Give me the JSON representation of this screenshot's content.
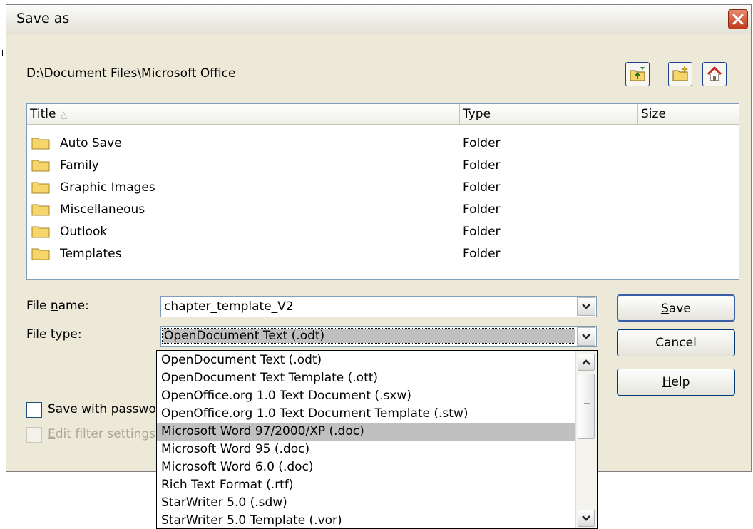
{
  "dialog": {
    "title": "Save as"
  },
  "path": "D:\\Document Files\\Microsoft Office",
  "icons": {
    "up": "folder-up-icon",
    "new_folder": "new-folder-icon",
    "home": "home-icon",
    "close": "close-icon"
  },
  "columns": {
    "title": "Title",
    "sort_glyph": "△",
    "type": "Type",
    "size": "Size"
  },
  "files": [
    {
      "name": "Auto Save",
      "type": "Folder"
    },
    {
      "name": "Family",
      "type": "Folder"
    },
    {
      "name": "Graphic Images",
      "type": "Folder"
    },
    {
      "name": "Miscellaneous",
      "type": "Folder"
    },
    {
      "name": "Outlook",
      "type": "Folder"
    },
    {
      "name": "Templates",
      "type": "Folder"
    }
  ],
  "form": {
    "filename_label_pre": "File ",
    "filename_label_key": "n",
    "filename_label_post": "ame:",
    "filename_value": "chapter_template_V2",
    "filetype_label_pre": "File ",
    "filetype_label_key": "t",
    "filetype_label_post": "ype:",
    "filetype_value": "OpenDocument Text (.odt)"
  },
  "buttons": {
    "save_key": "S",
    "save_rest": "ave",
    "cancel": "Cancel",
    "help_key": "H",
    "help_rest": "elp"
  },
  "checkboxes": {
    "password_pre": "Save ",
    "password_key": "w",
    "password_post": "ith passwo",
    "filter_key": "E",
    "filter_post": "dit filter settings"
  },
  "filetype_options": [
    "OpenDocument Text (.odt)",
    "OpenDocument Text Template (.ott)",
    "OpenOffice.org 1.0 Text Document (.sxw)",
    "OpenOffice.org 1.0 Text Document Template (.stw)",
    "Microsoft Word 97/2000/XP (.doc)",
    "Microsoft Word 95 (.doc)",
    "Microsoft Word 6.0 (.doc)",
    "Rich Text Format (.rtf)",
    "StarWriter 5.0 (.sdw)",
    "StarWriter 5.0 Template (.vor)"
  ],
  "highlighted_option": 4,
  "colors": {
    "highlight": "#c0c0c0",
    "dialog_bg": "#ece9d8",
    "folder": "#f6d66a",
    "close": "#c1391c"
  }
}
